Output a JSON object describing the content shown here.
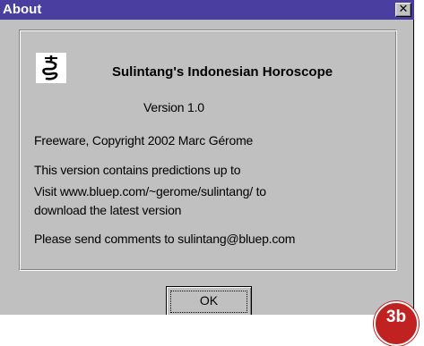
{
  "window": {
    "title": "About",
    "close_glyph": "✕"
  },
  "app": {
    "icon": "dragon-logo-icon",
    "title": "Sulintang's Indonesian Horoscope",
    "version": "Version 1.0"
  },
  "info": {
    "copyright": "Freeware, Copyright 2002 Marc Gérome",
    "predictions": "This version contains predictions up to",
    "visit": "Visit www.bluep.com/~gerome/sulintang/ to",
    "download": "download the latest version",
    "comments": "Please send comments to sulintang@bluep.com"
  },
  "buttons": {
    "ok": "OK"
  },
  "badge": {
    "text": "3b"
  },
  "colors": {
    "titlebar": "#4a3ea0",
    "badge": "#c02222",
    "face": "#c0c0c0"
  }
}
